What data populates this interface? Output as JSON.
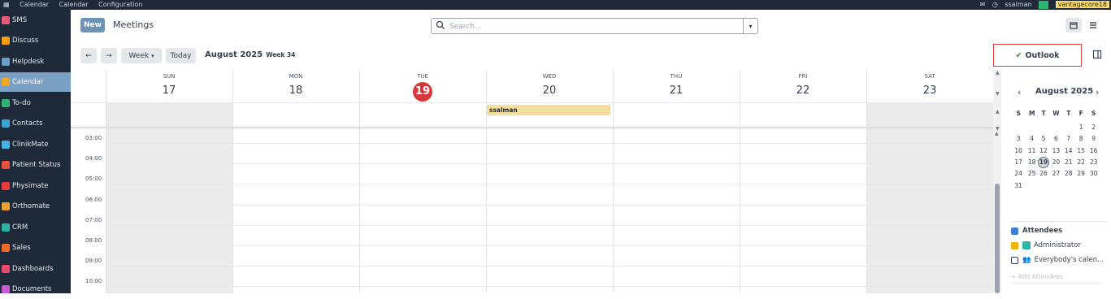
{
  "topbar": {
    "menu": [
      "Calendar",
      "Calendar",
      "Configuration"
    ],
    "user": "ssalman",
    "company": "vantagecore18"
  },
  "sidebar": {
    "items": [
      {
        "label": "SMS",
        "color": "#e85d75",
        "active": false
      },
      {
        "label": "Discuss",
        "color": "#f59e0b",
        "active": false
      },
      {
        "label": "Helpdesk",
        "color": "#6b9ec4",
        "active": false
      },
      {
        "label": "Calendar",
        "color": "#f6a623",
        "active": true
      },
      {
        "label": "To-do",
        "color": "#2bb673",
        "active": false
      },
      {
        "label": "Contacts",
        "color": "#3aa2d6",
        "active": false
      },
      {
        "label": "ClinikMate",
        "color": "#46b3e6",
        "active": false
      },
      {
        "label": "Patient Status",
        "color": "#e8503a",
        "active": false
      },
      {
        "label": "Physimate",
        "color": "#e83a3a",
        "active": false
      },
      {
        "label": "Orthomate",
        "color": "#f0a030",
        "active": false
      },
      {
        "label": "CRM",
        "color": "#2bb3a8",
        "active": false
      },
      {
        "label": "Sales",
        "color": "#f06a2a",
        "active": false
      },
      {
        "label": "Dashboards",
        "color": "#e84a6a",
        "active": false
      },
      {
        "label": "Documents",
        "color": "#c85ad6",
        "active": false
      }
    ]
  },
  "header": {
    "new_label": "New",
    "title": "Meetings"
  },
  "search": {
    "placeholder": "Search..."
  },
  "nav": {
    "prev": "←",
    "next": "→",
    "scale": "Week",
    "today": "Today",
    "period": "August 2025",
    "week": "Week 34"
  },
  "outlook": {
    "label": "Outlook"
  },
  "days": [
    {
      "name": "SUN",
      "num": "17",
      "today": false
    },
    {
      "name": "MON",
      "num": "18",
      "today": false
    },
    {
      "name": "TUE",
      "num": "19",
      "today": true
    },
    {
      "name": "WED",
      "num": "20",
      "today": false
    },
    {
      "name": "THU",
      "num": "21",
      "today": false
    },
    {
      "name": "FRI",
      "num": "22",
      "today": false
    },
    {
      "name": "SAT",
      "num": "23",
      "today": false
    }
  ],
  "event": {
    "title": "ssalman"
  },
  "times": [
    "03:00",
    "04:00",
    "05:00",
    "06:00",
    "07:00",
    "08:00",
    "09:00",
    "10:00"
  ],
  "mini": {
    "month": "August 2025",
    "weekdays": [
      "S",
      "M",
      "T",
      "W",
      "T",
      "F",
      "S"
    ],
    "weeks": [
      [
        "",
        "",
        "",
        "",
        "",
        "1",
        "2"
      ],
      [
        "3",
        "4",
        "5",
        "6",
        "7",
        "8",
        "9"
      ],
      [
        "10",
        "11",
        "12",
        "13",
        "14",
        "15",
        "16"
      ],
      [
        "17",
        "18",
        "19",
        "20",
        "21",
        "22",
        "23"
      ],
      [
        "24",
        "25",
        "26",
        "27",
        "28",
        "29",
        "30"
      ],
      [
        "31",
        "",
        "",
        "",
        "",
        "",
        ""
      ]
    ]
  },
  "attendees": {
    "title": "Attendees",
    "items": [
      "Administrator",
      "Everybody's calen..."
    ],
    "add_placeholder": "+ Add Attendees"
  },
  "colors": {
    "accent": "#6c94b8",
    "today": "#d9383b",
    "event": "#f4df9f",
    "outlook_border": "#e03c3c",
    "sidebar": "#1e2a3a"
  }
}
